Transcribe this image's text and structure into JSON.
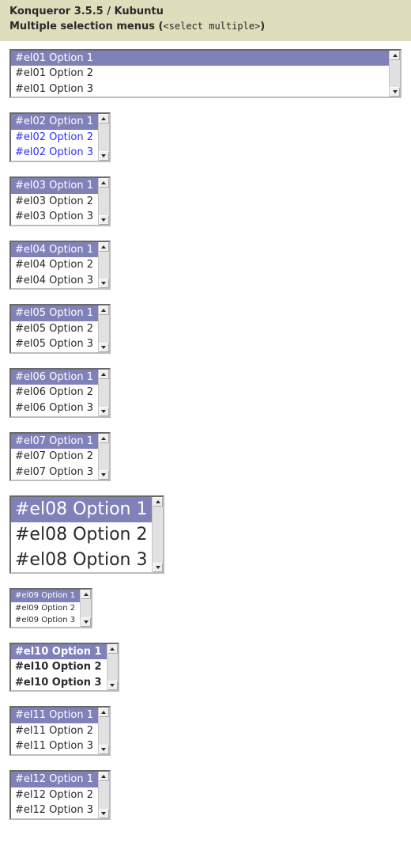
{
  "header": {
    "line1": "Konqueror 3.5.5 / Kubuntu",
    "line2_prefix": "Multiple selection menus (",
    "line2_code": "<select multiple>",
    "line2_suffix": ")"
  },
  "selection_bg": "#8181ba",
  "selects": [
    {
      "id": "el01",
      "full_width": true,
      "options": [
        "#el01 Option 1",
        "#el01 Option 2",
        "#el01 Option 3"
      ],
      "selected": [
        0
      ],
      "text_style": ""
    },
    {
      "id": "el02",
      "full_width": false,
      "options": [
        "#el02 Option 1",
        "#el02 Option 2",
        "#el02 Option 3"
      ],
      "selected": [
        0
      ],
      "text_style": "el02"
    },
    {
      "id": "el03",
      "full_width": false,
      "options": [
        "#el03 Option 1",
        "#el03 Option 2",
        "#el03 Option 3"
      ],
      "selected": [
        0
      ],
      "text_style": ""
    },
    {
      "id": "el04",
      "full_width": false,
      "options": [
        "#el04 Option 1",
        "#el04 Option 2",
        "#el04 Option 3"
      ],
      "selected": [
        0
      ],
      "text_style": ""
    },
    {
      "id": "el05",
      "full_width": false,
      "options": [
        "#el05 Option 1",
        "#el05 Option 2",
        "#el05 Option 3"
      ],
      "selected": [
        0
      ],
      "text_style": ""
    },
    {
      "id": "el06",
      "full_width": false,
      "options": [
        "#el06 Option 1",
        "#el06 Option 2",
        "#el06 Option 3"
      ],
      "selected": [
        0
      ],
      "text_style": ""
    },
    {
      "id": "el07",
      "full_width": false,
      "options": [
        "#el07 Option 1",
        "#el07 Option 2",
        "#el07 Option 3"
      ],
      "selected": [
        0
      ],
      "text_style": ""
    },
    {
      "id": "el08",
      "full_width": false,
      "options": [
        "#el08 Option 1",
        "#el08 Option 2",
        "#el08 Option 3"
      ],
      "selected": [
        0
      ],
      "text_style": "fs-large"
    },
    {
      "id": "el09",
      "full_width": false,
      "options": [
        "#el09 Option 1",
        "#el09 Option 2",
        "#el09 Option 3"
      ],
      "selected": [
        0
      ],
      "text_style": "fs-small"
    },
    {
      "id": "el10",
      "full_width": false,
      "options": [
        "#el10 Option 1",
        "#el10 Option 2",
        "#el10 Option 3"
      ],
      "selected": [
        0
      ],
      "text_style": "fw-bold"
    },
    {
      "id": "el11",
      "full_width": false,
      "options": [
        "#el11 Option 1",
        "#el11 Option 2",
        "#el11 Option 3"
      ],
      "selected": [
        0
      ],
      "text_style": ""
    },
    {
      "id": "el12",
      "full_width": false,
      "options": [
        "#el12 Option 1",
        "#el12 Option 2",
        "#el12 Option 3"
      ],
      "selected": [
        0
      ],
      "text_style": ""
    }
  ]
}
